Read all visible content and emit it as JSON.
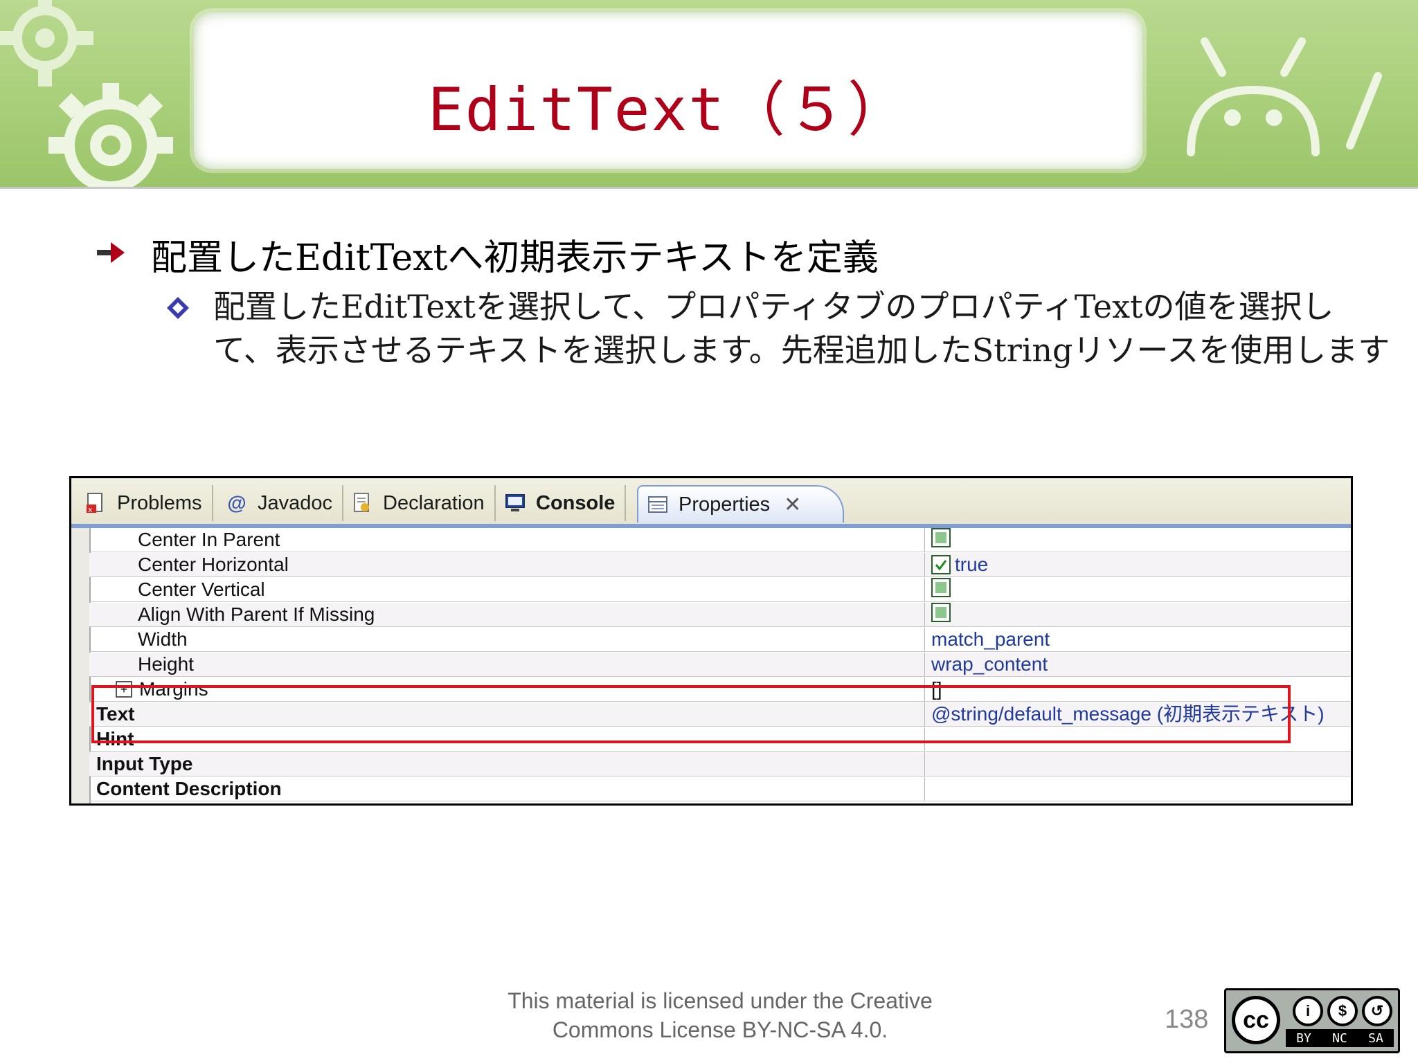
{
  "slide": {
    "title": "EditText（５）",
    "bullet_main": "配置したEditTextへ初期表示テキストを定義",
    "bullet_sub": "配置したEditTextを選択して、プロパティタブのプロパティTextの値を選択して、表示させるテキストを選択します。先程追加したStringリソースを使用します",
    "footer_line1": "This material is licensed under the Creative",
    "footer_line2": "Commons License BY-NC-SA 4.0.",
    "page_number": "138"
  },
  "tabs": [
    {
      "label": "Problems",
      "icon": "problems-icon"
    },
    {
      "label": "Javadoc",
      "icon": "at-icon"
    },
    {
      "label": "Declaration",
      "icon": "declaration-icon"
    },
    {
      "label": "Console",
      "icon": "console-icon"
    },
    {
      "label": "Properties",
      "icon": "properties-icon"
    }
  ],
  "properties": [
    {
      "name": "Center In Parent",
      "value": ""
    },
    {
      "name": "Center Horizontal",
      "value": "true"
    },
    {
      "name": "Center Vertical",
      "value": ""
    },
    {
      "name": "Align With Parent If Missing",
      "value": ""
    },
    {
      "name": "Width",
      "value": "match_parent"
    },
    {
      "name": "Height",
      "value": "wrap_content"
    },
    {
      "name": "Margins",
      "value": "[]"
    },
    {
      "name": "Text",
      "value": "@string/default_message (初期表示テキスト)"
    },
    {
      "name": "Hint",
      "value": ""
    },
    {
      "name": "Input Type",
      "value": ""
    },
    {
      "name": "Content Description",
      "value": ""
    }
  ],
  "license": {
    "cc": "cc",
    "strip": [
      "BY",
      "NC",
      "SA"
    ]
  },
  "colors": {
    "title": "#b00019",
    "highlight": "#e0141c",
    "value_text": "#1f3a9c",
    "banner": "#a9cf7a"
  }
}
